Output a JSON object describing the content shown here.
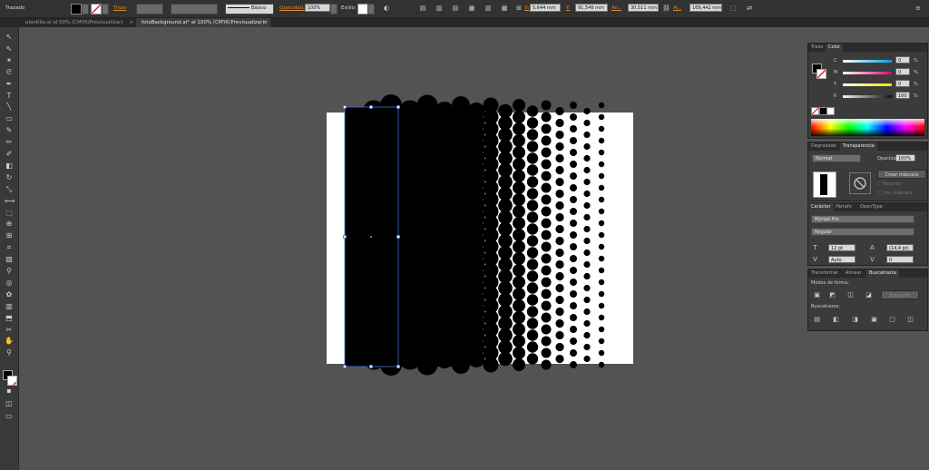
{
  "control_bar": {
    "selection_type": "Trazado",
    "stroke_label": "Trazo",
    "stroke_style": "Básico",
    "opacity_label": "Opacidad:",
    "opacity_value": "100%",
    "style_label": "Estilo:",
    "x_label": "X:",
    "x_value": "5,644 mm",
    "y_label": "Y:",
    "y_value": "91,546 mm",
    "width_label": "An.:",
    "width_value": "30,511 mm",
    "height_label": "Al.:",
    "height_value": "169,442 mm"
  },
  "document_tabs": [
    {
      "label": "plantilla.ai al 50% (CMYK/Previsualizar)",
      "active": false
    },
    {
      "label": "fotoBackground.ai* al 100% (CMYK/Previsualizar)",
      "active": true
    }
  ],
  "tool_icons": [
    "selection-tool",
    "direct-selection-tool",
    "magic-wand-tool",
    "lasso-tool",
    "pen-tool",
    "type-tool",
    "line-tool",
    "rectangle-tool",
    "paintbrush-tool",
    "pencil-tool",
    "blob-brush-tool",
    "eraser-tool",
    "rotate-tool",
    "scale-tool",
    "width-tool",
    "free-transform-tool",
    "shape-builder-tool",
    "perspective-grid-tool",
    "mesh-tool",
    "gradient-tool",
    "eyedropper-tool",
    "blend-tool",
    "symbol-sprayer-tool",
    "column-graph-tool",
    "artboard-tool",
    "slice-tool",
    "hand-tool",
    "zoom-tool"
  ],
  "color_panel": {
    "tabs": [
      "Trazo",
      "Color"
    ],
    "channels": [
      {
        "label": "C",
        "value": "0",
        "unit": "%"
      },
      {
        "label": "M",
        "value": "0",
        "unit": "%"
      },
      {
        "label": "Y",
        "value": "0",
        "unit": "%"
      },
      {
        "label": "K",
        "value": "100",
        "unit": "%"
      }
    ]
  },
  "transparency_panel": {
    "tabs": [
      "Degradado",
      "Transparencia"
    ],
    "blend_mode": "Normal",
    "opacity_label": "Opacidad:",
    "opacity_value": "100%",
    "make_mask_button": "Crear máscara",
    "clip_label": "Recortar",
    "invert_mask_label": "Inv. máscara"
  },
  "character_panel": {
    "tabs": [
      "Carácter",
      "Párrafo",
      "OpenType"
    ],
    "font_family": "Myriad Pro",
    "font_style": "Regular",
    "font_size": "12 pt",
    "leading": "(14,4 pt)",
    "kerning": "Auto",
    "tracking": "0"
  },
  "pathfinder_panel": {
    "tabs": [
      "Transformar",
      "Alinear",
      "Buscatrazos"
    ],
    "shape_modes_label": "Modos de forma:",
    "expand_button": "Expandir",
    "pathfinders_label": "Buscatrazos:"
  },
  "colors": {
    "fill": "#000000",
    "artboard": "#ffffff",
    "selection": "#4a6fd8",
    "accent_label": "#d88a2e"
  }
}
